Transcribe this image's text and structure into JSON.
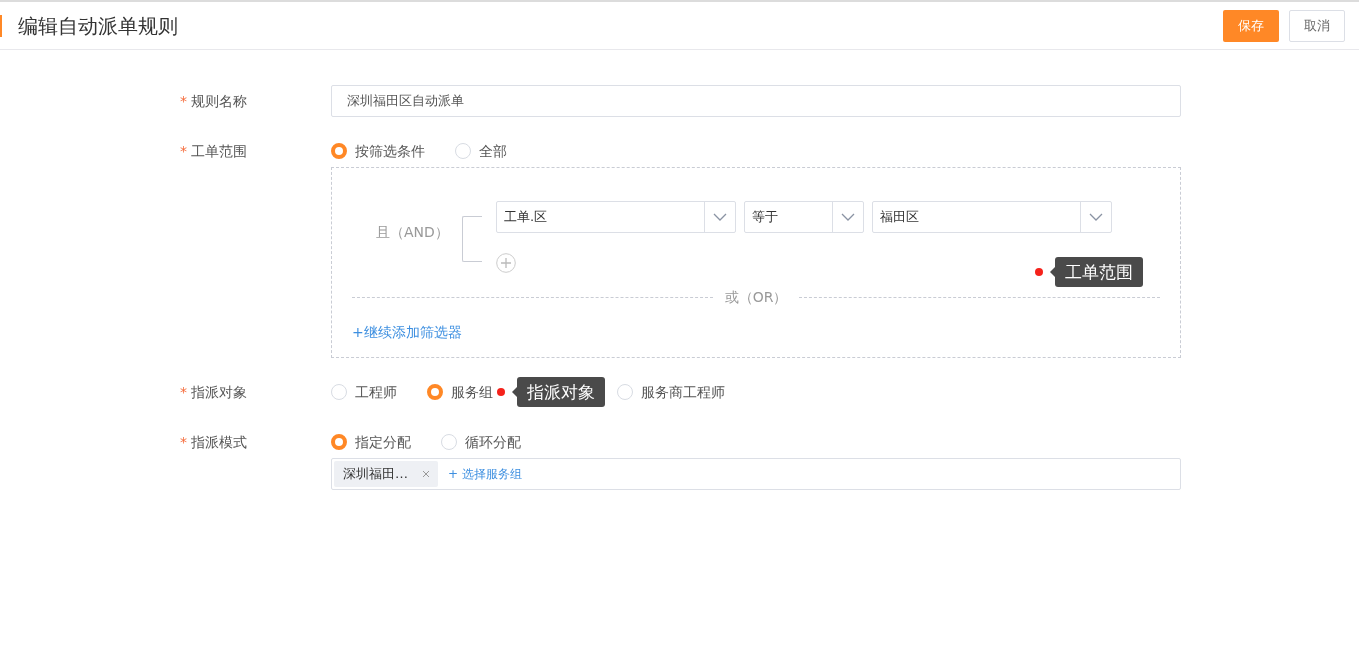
{
  "header": {
    "title": "编辑自动派单规则",
    "buttons": [
      {
        "label": "保存",
        "kind": "primary"
      },
      {
        "label": "取消",
        "kind": "default"
      }
    ]
  },
  "form": {
    "name_row": {
      "label": "规则名称",
      "required_mark": "*",
      "value": "深圳福田区自动派单"
    },
    "scope_row": {
      "label": "工单范围",
      "required_mark": "*",
      "options": [
        {
          "label": "按筛选条件",
          "selected": true
        },
        {
          "label": "全部",
          "selected": false
        }
      ],
      "filter_group": {
        "logic": "且（AND）",
        "conditions": [
          {
            "field": "工单.区",
            "operator": "等于",
            "value": "福田区"
          }
        ]
      },
      "or_divider": "或（OR）",
      "add_filter": "+继续添加筛选器",
      "annotation": "工单范围"
    },
    "target_row": {
      "label": "指派对象",
      "required_mark": "*",
      "options": [
        {
          "label": "工程师",
          "selected": false
        },
        {
          "label": "服务组",
          "selected": true
        },
        {
          "label": "服务商工程师",
          "selected": false
        }
      ],
      "annotation": "指派对象"
    },
    "mode_row": {
      "label": "指派模式",
      "required_mark": "*",
      "options": [
        {
          "label": "指定分配",
          "selected": true
        },
        {
          "label": "循环分配",
          "selected": false
        }
      ],
      "tags": [
        "深圳福田…"
      ],
      "add_link": "+ 选择服务组"
    }
  }
}
